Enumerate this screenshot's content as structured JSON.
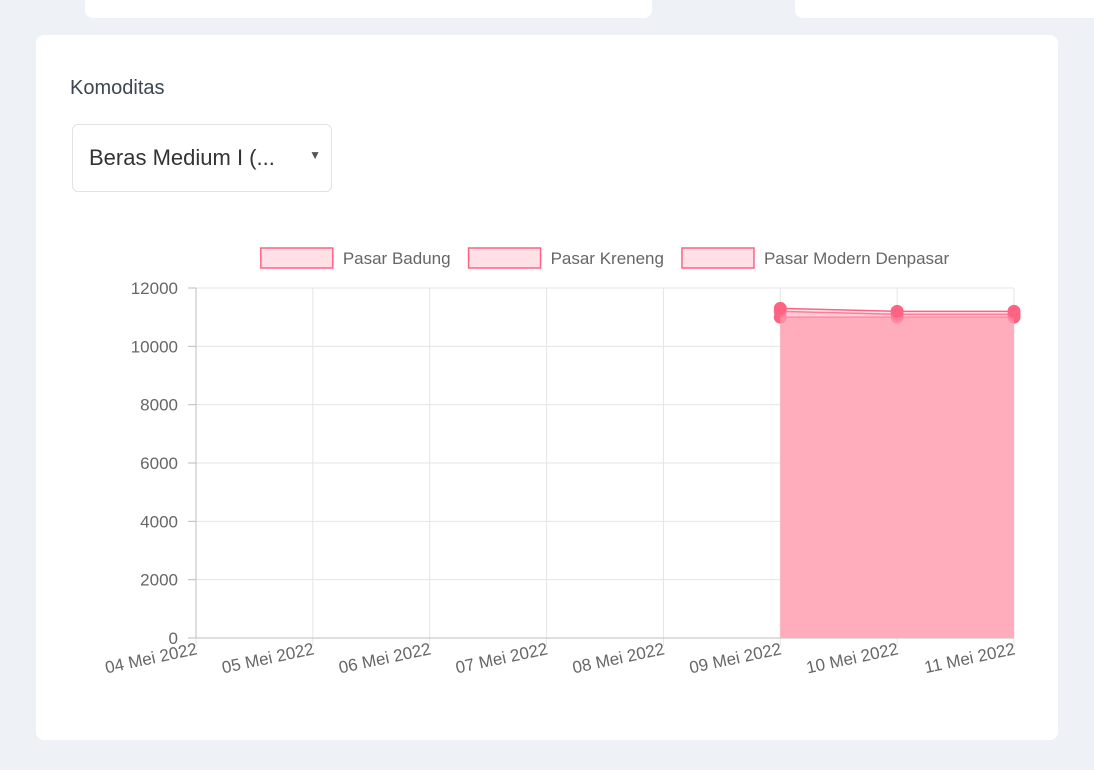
{
  "form": {
    "label": "Komoditas",
    "selected": "Beras Medium I (...",
    "caret_icon": "caret-down-icon"
  },
  "colors": {
    "fill": "#ffacbd",
    "legend_fill": "#ffe0e6",
    "line": "#ff6384",
    "grid": "#e5e5e5",
    "text": "#666666"
  },
  "chart_data": {
    "type": "area",
    "title": "",
    "xlabel": "",
    "ylabel": "",
    "categories": [
      "04 Mei 2022",
      "05 Mei 2022",
      "06 Mei 2022",
      "07 Mei 2022",
      "08 Mei 2022",
      "09 Mei 2022",
      "10 Mei 2022",
      "11 Mei 2022"
    ],
    "ylim": [
      0,
      12000
    ],
    "yticks": [
      0,
      2000,
      4000,
      6000,
      8000,
      10000,
      12000
    ],
    "grid": true,
    "legend": "top-center",
    "series": [
      {
        "name": "Pasar Badung",
        "values": [
          null,
          null,
          null,
          null,
          null,
          11000,
          11000,
          11000
        ]
      },
      {
        "name": "Pasar Kreneng",
        "values": [
          null,
          null,
          null,
          null,
          null,
          11200,
          11100,
          11100
        ]
      },
      {
        "name": "Pasar Modern Denpasar",
        "values": [
          null,
          null,
          null,
          null,
          null,
          11300,
          11200,
          11200
        ]
      }
    ]
  }
}
